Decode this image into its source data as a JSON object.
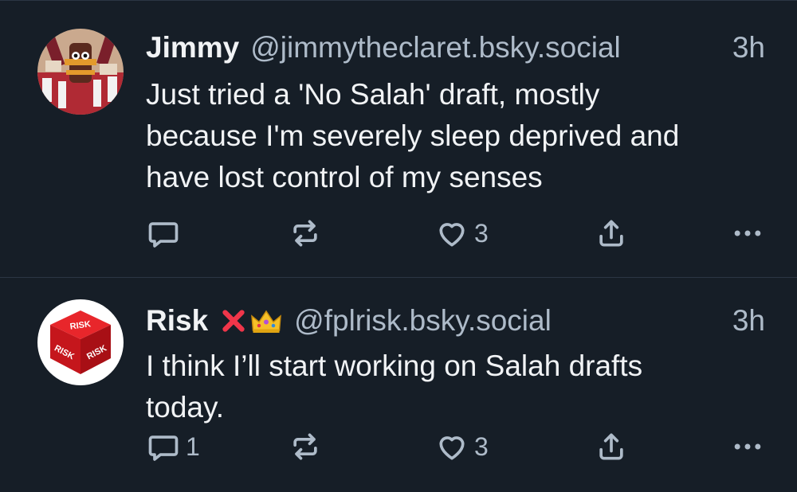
{
  "posts": [
    {
      "display_name": "Jimmy",
      "handle": "@jimmytheclaret.bsky.social",
      "time": "3h",
      "text_lines": [
        "Just tried a 'No Salah' draft, mostly",
        "because I'm severely sleep deprived and",
        "have lost control of my senses"
      ],
      "reply_count": "",
      "like_count": "3",
      "avatar_icon": "claret-fan-avatar"
    },
    {
      "display_name": "Risk",
      "badges": [
        "cross-mark-emoji",
        "crown-emoji"
      ],
      "handle": "@fplrisk.bsky.social",
      "time": "3h",
      "text_lines": [
        "I think I’ll start working on Salah drafts",
        "today."
      ],
      "reply_count": "1",
      "like_count": "3",
      "avatar_icon": "risk-dice-avatar",
      "avatar_text": "RISK"
    }
  ],
  "colors": {
    "background": "#161e27",
    "divider": "#2b3644",
    "text": "#f1f3f5",
    "muted": "#aebbc9",
    "avatar_red": "#d8161c",
    "claret": "#7a1f2b"
  }
}
